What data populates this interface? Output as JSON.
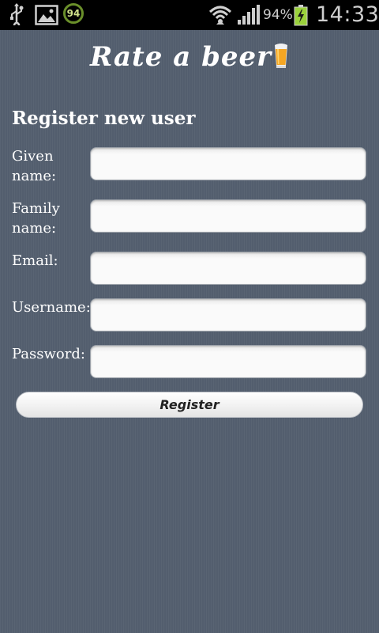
{
  "status_bar": {
    "notification_count": "94",
    "battery_percent": "94%",
    "time": "14:33",
    "icons": [
      "usb-icon",
      "gallery-icon",
      "sync-badge-icon",
      "wifi-icon",
      "signal-icon",
      "battery-charging-icon"
    ]
  },
  "app": {
    "title": "Rate a beer",
    "logo_icon": "beer-glass-icon"
  },
  "form": {
    "heading": "Register new user",
    "fields": [
      {
        "label": "Given name:",
        "value": "",
        "placeholder": ""
      },
      {
        "label": "Family name:",
        "value": "",
        "placeholder": ""
      },
      {
        "label": "Email:",
        "value": "",
        "placeholder": ""
      },
      {
        "label": "Username:",
        "value": "",
        "placeholder": ""
      },
      {
        "label": "Password:",
        "value": "",
        "placeholder": ""
      }
    ],
    "submit_label": "Register"
  },
  "colors": {
    "background": "#535e6e",
    "status_bar": "#000000"
  }
}
